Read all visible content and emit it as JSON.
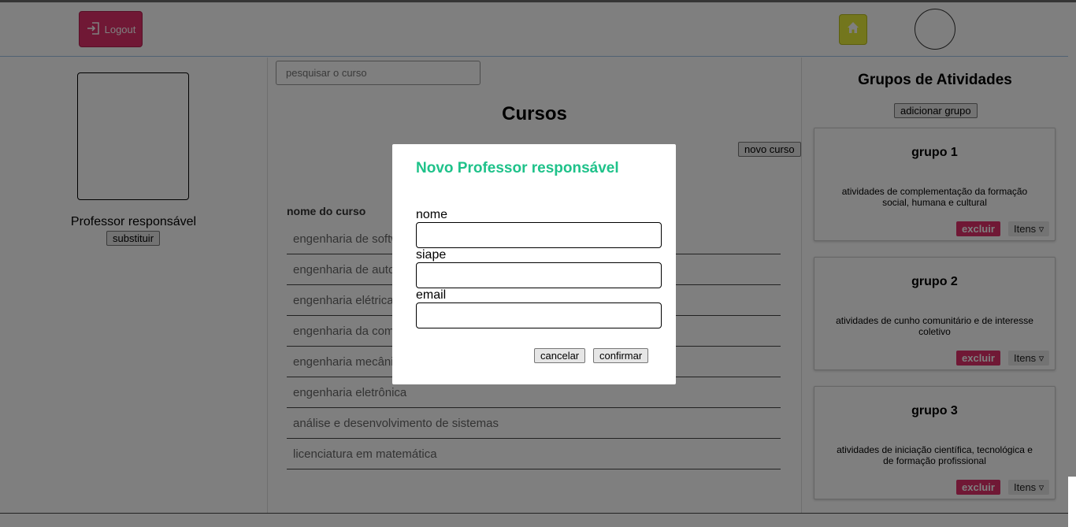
{
  "header": {
    "logout_label": "Logout"
  },
  "left": {
    "professor_label": "Professor responsável",
    "substituir_label": "substituir"
  },
  "center": {
    "search_placeholder": "pesquisar o curso",
    "title": "Cursos",
    "novo_curso_label": "novo curso",
    "column_header": "nome do curso",
    "courses": [
      "engenharia de software",
      "engenharia de automação",
      "engenharia elétrica",
      "engenharia da computação",
      "engenharia mecânica",
      "engenharia eletrônica",
      "análise e desenvolvimento de sistemas",
      "licenciatura em matemática"
    ]
  },
  "right": {
    "title": "Grupos de Atividades",
    "add_label": "adicionar grupo",
    "groups": [
      {
        "name": "grupo 1",
        "description": "atividades de complementação da formação social, humana e cultural",
        "excluir": "excluir",
        "itens": "Itens ▿"
      },
      {
        "name": "grupo 2",
        "description": "atividades de cunho comunitário e de interesse coletivo",
        "excluir": "excluir",
        "itens": "Itens ▿"
      },
      {
        "name": "grupo 3",
        "description": "atividades de iniciação científica, tecnológica e de formação profissional",
        "excluir": "excluir",
        "itens": "Itens ▿"
      }
    ]
  },
  "modal": {
    "title": "Novo Professor responsável",
    "fields": {
      "nome": "nome",
      "siape": "siape",
      "email": "email"
    },
    "values": {
      "nome": "",
      "siape": "",
      "email": ""
    },
    "cancel_label": "cancelar",
    "confirm_label": "confirmar"
  },
  "colors": {
    "logout": "#e0306a",
    "home": "#e7ec3a",
    "modal_title": "#1fc28a",
    "excluir": "#e0306a",
    "header_border": "#9ec3e6"
  }
}
